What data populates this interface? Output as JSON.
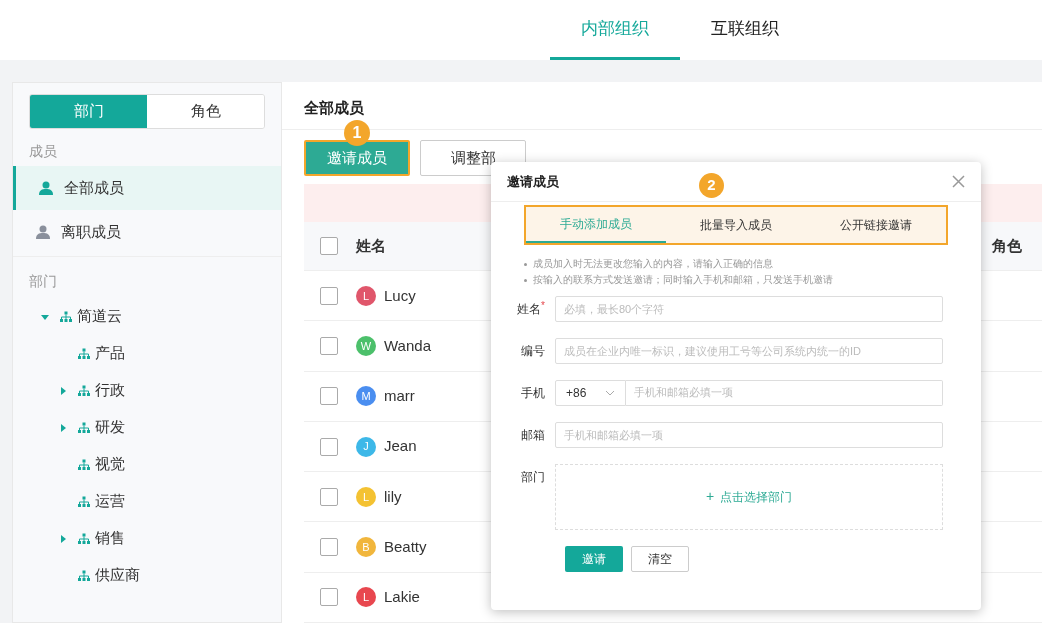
{
  "header_tabs": [
    {
      "label": "内部组织",
      "selected": true
    },
    {
      "label": "互联组织",
      "selected": false
    }
  ],
  "sidebar": {
    "switch": [
      {
        "label": "部门",
        "selected": true
      },
      {
        "label": "角色",
        "selected": false
      }
    ],
    "members_heading": "成员",
    "member_items": [
      {
        "label": "全部成员",
        "selected": true
      },
      {
        "label": "离职成员",
        "selected": false
      }
    ],
    "departments_heading": "部门",
    "tree": [
      {
        "label": "简道云",
        "expanded": true,
        "children": [
          {
            "label": "产品"
          },
          {
            "label": "行政",
            "expanded": false
          },
          {
            "label": "研发",
            "expanded": false
          },
          {
            "label": "视觉"
          },
          {
            "label": "运营"
          },
          {
            "label": "销售",
            "expanded": false
          },
          {
            "label": "供应商"
          }
        ]
      }
    ]
  },
  "main": {
    "title": "全部成员",
    "callout_1": "1",
    "toolbar": [
      {
        "label": "邀请成员",
        "kind": "primary"
      },
      {
        "label": "调整部",
        "kind": "default"
      }
    ],
    "table": {
      "columns": [
        "姓名",
        "角色"
      ],
      "all_checked": false,
      "rows": [
        {
          "name": "Lucy",
          "initial": "L",
          "color": "#e0566b",
          "checked": false
        },
        {
          "name": "Wanda",
          "initial": "W",
          "color": "#4cc06b",
          "checked": false
        },
        {
          "name": "marr",
          "initial": "M",
          "color": "#4a8ef0",
          "checked": false
        },
        {
          "name": "Jean",
          "initial": "J",
          "color": "#3db8e8",
          "checked": false
        },
        {
          "name": "lily",
          "initial": "L",
          "color": "#f4c232",
          "checked": false
        },
        {
          "name": "Beatty",
          "initial": "B",
          "color": "#f1b63c",
          "checked": false
        },
        {
          "name": "Lakie",
          "initial": "L",
          "color": "#e8474f",
          "checked": false
        }
      ]
    }
  },
  "dialog": {
    "title": "邀请成员",
    "callout_2": "2",
    "tabs": [
      {
        "label": "手动添加成员",
        "selected": true
      },
      {
        "label": "批量导入成员",
        "selected": false
      },
      {
        "label": "公开链接邀请",
        "selected": false
      }
    ],
    "notes": [
      "成员加入时无法更改您输入的内容，请输入正确的信息",
      "按输入的联系方式发送邀请；同时输入手机和邮箱，只发送手机邀请"
    ],
    "fields": [
      {
        "kind": "text",
        "label": "姓名",
        "required_mark": "*",
        "placeholder": "必填，最长80个字符"
      },
      {
        "kind": "text",
        "label": "编号",
        "placeholder": "成员在企业内唯一标识，建议使用工号等公司系统内统一的ID"
      },
      {
        "kind": "phone",
        "label": "手机",
        "code": "+86",
        "placeholder": "手机和邮箱必填一项"
      },
      {
        "kind": "text",
        "label": "邮箱",
        "placeholder": "手机和邮箱必填一项"
      },
      {
        "kind": "picker",
        "label": "部门",
        "icon": "+",
        "action": "点击选择部门"
      }
    ],
    "buttons": [
      {
        "label": "邀请",
        "kind": "primary"
      },
      {
        "label": "清空",
        "kind": "default"
      }
    ]
  }
}
